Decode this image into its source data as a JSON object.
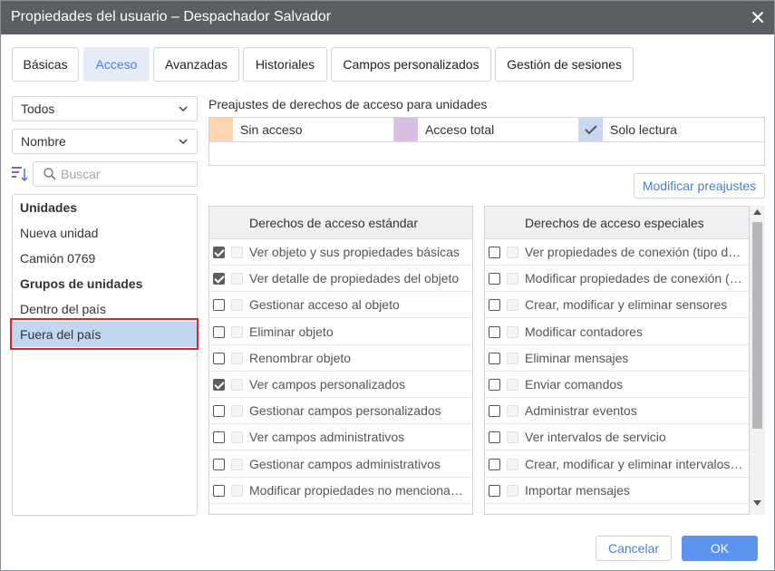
{
  "window": {
    "title": "Propiedades del usuario – Despachador Salvador"
  },
  "tabs": [
    {
      "label": "Básicas",
      "active": false
    },
    {
      "label": "Acceso",
      "active": true
    },
    {
      "label": "Avanzadas",
      "active": false
    },
    {
      "label": "Historiales",
      "active": false
    },
    {
      "label": "Campos personalizados",
      "active": false
    },
    {
      "label": "Gestión de sesiones",
      "active": false
    }
  ],
  "filters": {
    "type_select": "Todos",
    "sort_select": "Nombre",
    "search_placeholder": "Buscar"
  },
  "list": [
    {
      "label": "Unidades",
      "kind": "header"
    },
    {
      "label": "Nueva unidad",
      "kind": "item"
    },
    {
      "label": "Camión 0769",
      "kind": "item"
    },
    {
      "label": "Grupos de unidades",
      "kind": "header"
    },
    {
      "label": "Dentro del país",
      "kind": "item"
    },
    {
      "label": "Fuera del país",
      "kind": "item",
      "selected": true
    }
  ],
  "presets": {
    "label": "Preajustes de derechos de acceso para unidades",
    "items": [
      {
        "label": "Sin acceso",
        "color": "#fdd5b1"
      },
      {
        "label": "Acceso total",
        "color": "#d9bfe3"
      },
      {
        "label": "Solo lectura",
        "color": "#c9d8f2",
        "check": true
      }
    ],
    "modify_button": "Modificar preajustes"
  },
  "standard_rights": {
    "header": "Derechos de acceso estándar",
    "rows": [
      {
        "label": "Ver objeto y sus propiedades básicas",
        "checked": true
      },
      {
        "label": "Ver detalle de propiedades del objeto",
        "checked": true
      },
      {
        "label": "Gestionar acceso al objeto",
        "checked": false
      },
      {
        "label": "Eliminar objeto",
        "checked": false
      },
      {
        "label": "Renombrar objeto",
        "checked": false
      },
      {
        "label": "Ver campos personalizados",
        "checked": true
      },
      {
        "label": "Gestionar campos personalizados",
        "checked": false
      },
      {
        "label": "Ver campos administrativos",
        "checked": false
      },
      {
        "label": "Gestionar campos administrativos",
        "checked": false
      },
      {
        "label": "Modificar propiedades no mencionadas",
        "checked": false
      }
    ]
  },
  "special_rights": {
    "header": "Derechos de acceso especiales",
    "rows": [
      {
        "label": "Ver propiedades de conexión (tipo de dispositivo, ID único, teléfono)",
        "checked": false
      },
      {
        "label": "Modificar propiedades de conexión (tipo de dispositivo)",
        "checked": false
      },
      {
        "label": "Crear, modificar y eliminar sensores",
        "checked": false
      },
      {
        "label": "Modificar contadores",
        "checked": false
      },
      {
        "label": "Eliminar mensajes",
        "checked": false
      },
      {
        "label": "Enviar comandos",
        "checked": false
      },
      {
        "label": "Administrar eventos",
        "checked": false
      },
      {
        "label": "Ver intervalos de servicio",
        "checked": false
      },
      {
        "label": "Crear, modificar y eliminar intervalos de servicio",
        "checked": false
      },
      {
        "label": "Importar mensajes",
        "checked": false
      }
    ]
  },
  "footer": {
    "cancel_label": "Cancelar",
    "ok_label": "OK"
  }
}
